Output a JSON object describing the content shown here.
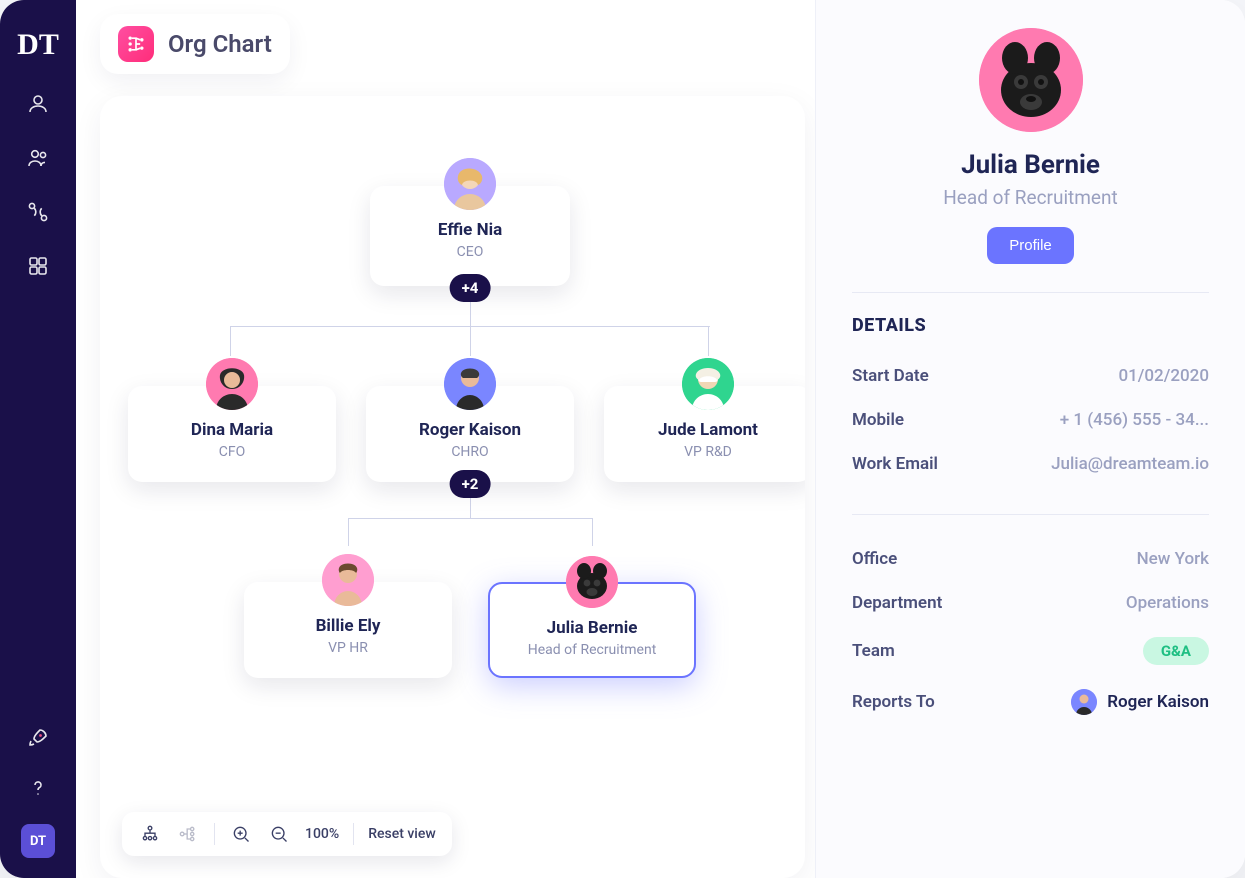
{
  "app_logo": "DT",
  "header": {
    "title": "Org Chart"
  },
  "sidebar_badge": "DT",
  "org": {
    "root": {
      "name": "Effie Nia",
      "role": "CEO",
      "childCount": "+4",
      "avatarBg": "#b9a9ff"
    },
    "level2": [
      {
        "name": "Dina Maria",
        "role": "CFO",
        "avatarBg": "#ff7ab0"
      },
      {
        "name": "Roger Kaison",
        "role": "CHRO",
        "childCount": "+2",
        "avatarBg": "#7a86ff"
      },
      {
        "name": "Jude Lamont",
        "role": "VP R&D",
        "avatarBg": "#2fd58f"
      }
    ],
    "level3": [
      {
        "name": "Billie Ely",
        "role": "VP HR",
        "avatarBg": "#ff9ed0"
      },
      {
        "name": "Julia Bernie",
        "role": "Head of Recruitment",
        "avatarBg": "#ff7ab0",
        "selected": true
      }
    ]
  },
  "toolbar": {
    "zoom": "100%",
    "reset": "Reset view"
  },
  "details": {
    "name": "Julia Bernie",
    "role": "Head of Recruitment",
    "profile_label": "Profile",
    "section_title": "DETAILS",
    "rows1": {
      "start_date": {
        "label": "Start Date",
        "value": "01/02/2020"
      },
      "mobile": {
        "label": "Mobile",
        "value": "+ 1 (456) 555 - 34..."
      },
      "work_email": {
        "label": "Work Email",
        "value": "Julia@dreamteam.io"
      }
    },
    "rows2": {
      "office": {
        "label": "Office",
        "value": "New York"
      },
      "department": {
        "label": "Department",
        "value": "Operations"
      },
      "team": {
        "label": "Team",
        "value": "G&A"
      },
      "reports_to": {
        "label": "Reports To",
        "value": "Roger Kaison"
      }
    }
  }
}
